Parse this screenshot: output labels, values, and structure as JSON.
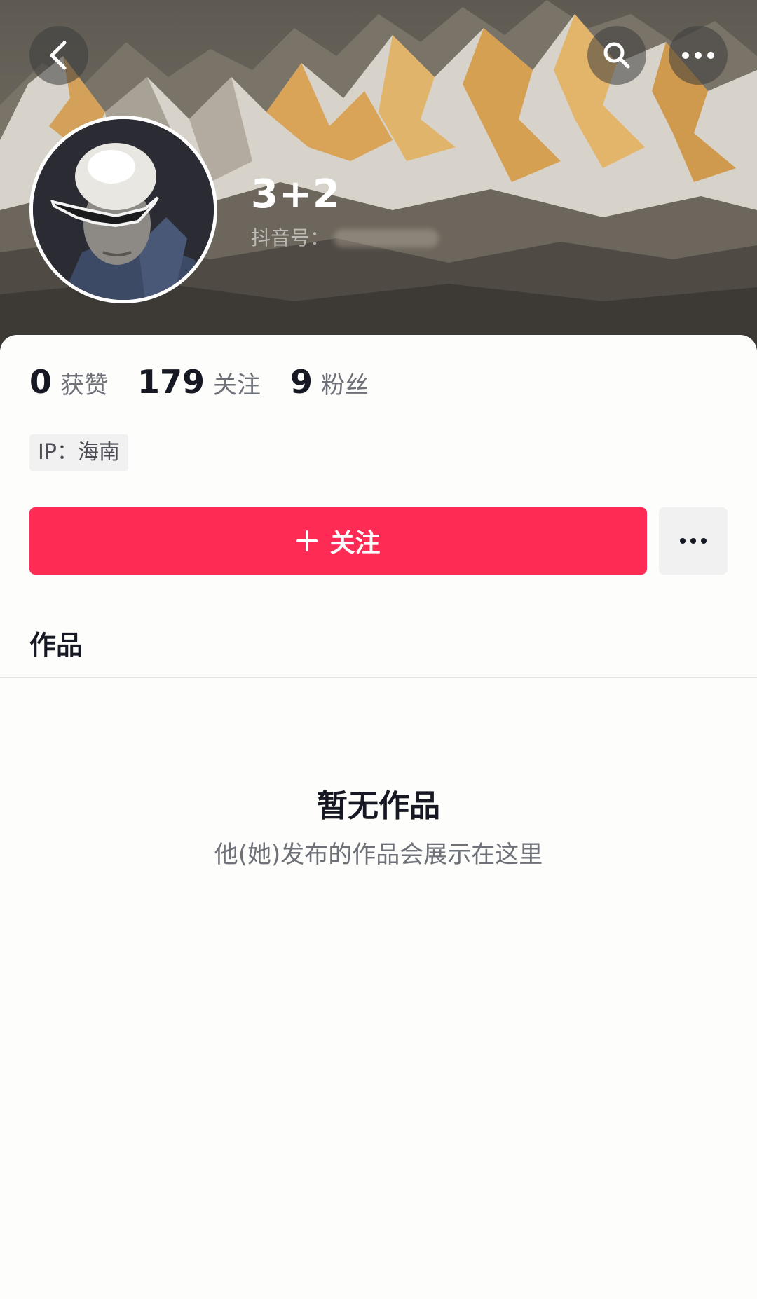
{
  "profile": {
    "nickname": "3+2",
    "douyin_id_label": "抖音号：",
    "ip_label": "IP：海南"
  },
  "stats": [
    {
      "value": "0",
      "label": "获赞"
    },
    {
      "value": "179",
      "label": "关注"
    },
    {
      "value": "9",
      "label": "粉丝"
    }
  ],
  "actions": {
    "follow_label": "关注"
  },
  "tabs": {
    "works_label": "作品"
  },
  "empty_state": {
    "title": "暂无作品",
    "subtitle": "他(她)发布的作品会展示在这里"
  },
  "colors": {
    "accent": "#fe2c55",
    "text_primary": "#161823",
    "text_secondary": "#6f7178",
    "tag_bg": "#f1f1f2"
  }
}
